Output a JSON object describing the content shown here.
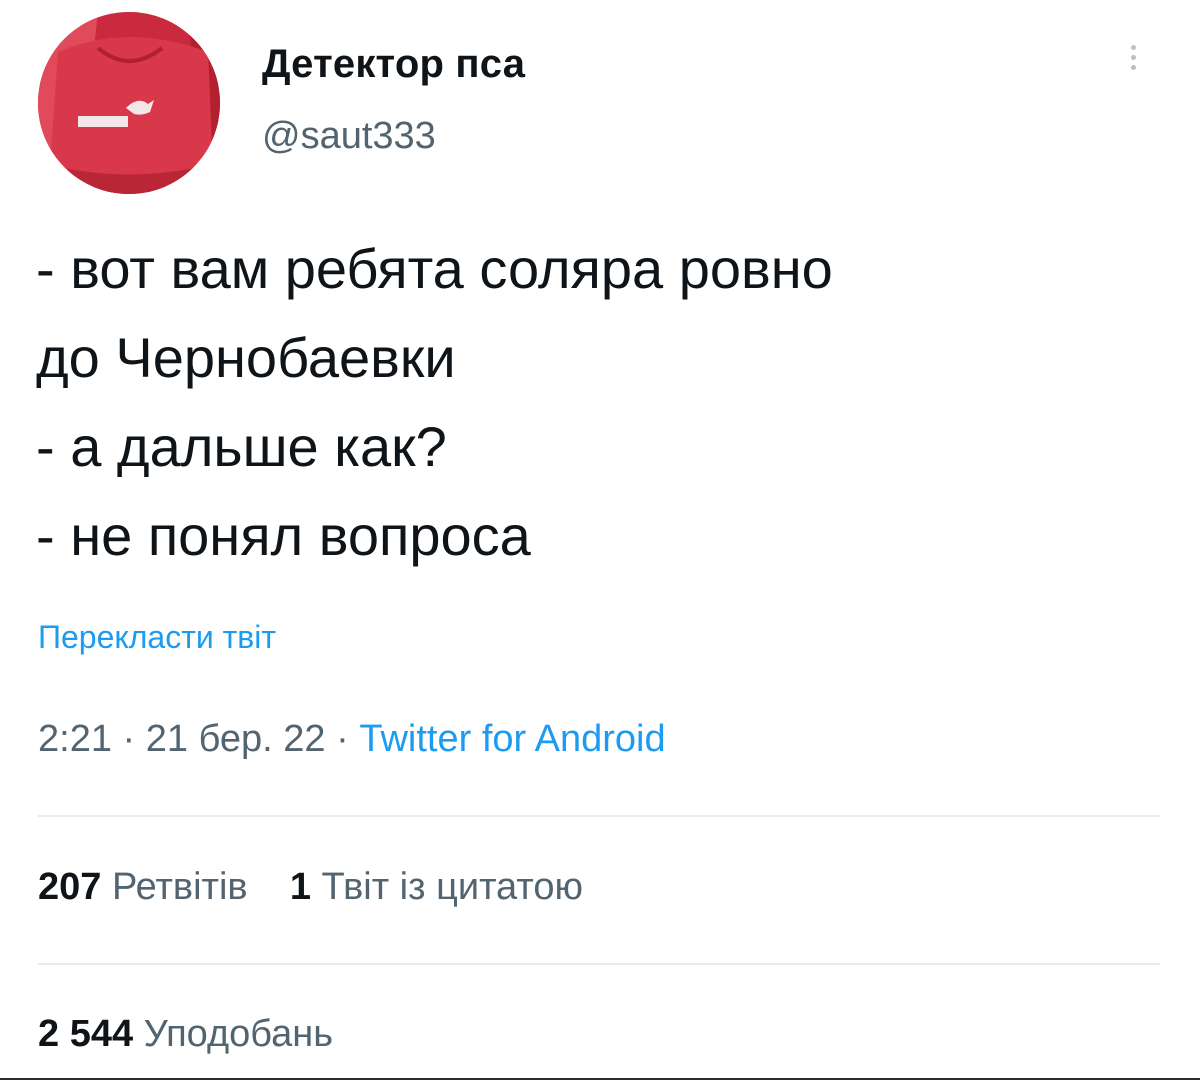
{
  "author": {
    "name": "Детектор пса",
    "handle": "@saut333",
    "avatar_icon": "puma-shirt-avatar"
  },
  "tweet": {
    "lines": [
      "- вот вам ребята соляра ровно",
      "до Чернобаевки",
      "- а дальше как?",
      "- не понял вопроса"
    ],
    "translate_label": "Перекласти твіт"
  },
  "meta": {
    "time": "2:21",
    "separator": "·",
    "date": "21 бер. 22",
    "source": "Twitter for Android"
  },
  "stats": {
    "retweets_count": "207",
    "retweets_label": "Ретвітів",
    "quotes_count": "1",
    "quotes_label": "Твіт із цитатою",
    "likes_count": "2 544",
    "likes_label": "Уподобань"
  },
  "colors": {
    "link": "#1d9bf0",
    "secondary_text": "#536471",
    "primary_text": "#0f1419",
    "avatar_bg": "#d8384a"
  },
  "icons": {
    "more": "more-vertical-icon"
  }
}
